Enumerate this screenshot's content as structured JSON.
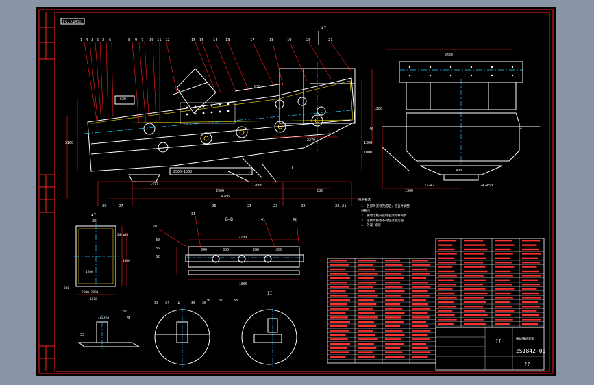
{
  "drawing": {
    "header_tag": "ZS-2462U",
    "top_ref": "A7",
    "part_numbers_top": [
      "1",
      "4",
      "3",
      "5",
      "2",
      "6",
      "8",
      "9",
      "7",
      "10",
      "11",
      "12",
      "15",
      "16",
      "14",
      "13",
      "17",
      "18",
      "19",
      "20",
      "21"
    ],
    "dims_main": {
      "overall_length": "4206",
      "d1": "2500",
      "d2": "2000",
      "d3": "820",
      "d4": "1477",
      "d5": "3100",
      "d6": "2500-1000",
      "d7": "1300",
      "d8": "1200",
      "d9": "1000",
      "d10": "2270",
      "d11": "830",
      "d12": "630",
      "label_t": "T",
      "side_ref": "40"
    },
    "bottom_labels_main": [
      "29",
      "27",
      "26",
      "25",
      "23",
      "22",
      "22,21"
    ],
    "side_view": {
      "width": "2420",
      "dim_a": "1300",
      "dim_b": "24-450",
      "dim_c": "400",
      "dim_d": "22-42",
      "ref": "2"
    },
    "notes": [
      "1. 各部件安装完成后，检查并调整",
      "   各部位",
      "2. 振动电机安装时必须对称同步",
      "3. 运转时振幅不得超过规定值",
      "4. 外观 涂漆"
    ],
    "notes_title": "技术要求",
    "view_a": {
      "title": "A7",
      "ref": "35",
      "dims": [
        "24-φ18",
        "1200",
        "1300",
        "230",
        "2600-1800",
        "1220"
      ]
    },
    "view_bb": {
      "title": "B—B",
      "labels": [
        "28",
        "31",
        "30",
        "36",
        "32",
        "41",
        "42"
      ],
      "dims": [
        "2200",
        "340",
        "300",
        "280",
        "300",
        "1860"
      ]
    },
    "details": {
      "detail1": {
        "labels": [
          "33",
          "32",
          "31"
        ],
        "dim": "40-460"
      },
      "detail2": {
        "labels": [
          "33",
          "34",
          "35",
          "36"
        ],
        "mark": "I"
      },
      "detail3": {
        "labels": [
          "36",
          "37",
          "38"
        ],
        "mark": "II"
      }
    },
    "title_block": {
      "drawing_no": "ZS1842-00",
      "name_line": "??",
      "company": "??",
      "sub": "振动筛总装图"
    },
    "colors": {
      "frame": "#ff2020",
      "lines": "#ffffff",
      "centerline": "#22c8ff",
      "hidden": "#00ff44",
      "highlight": "#ffe000"
    }
  }
}
